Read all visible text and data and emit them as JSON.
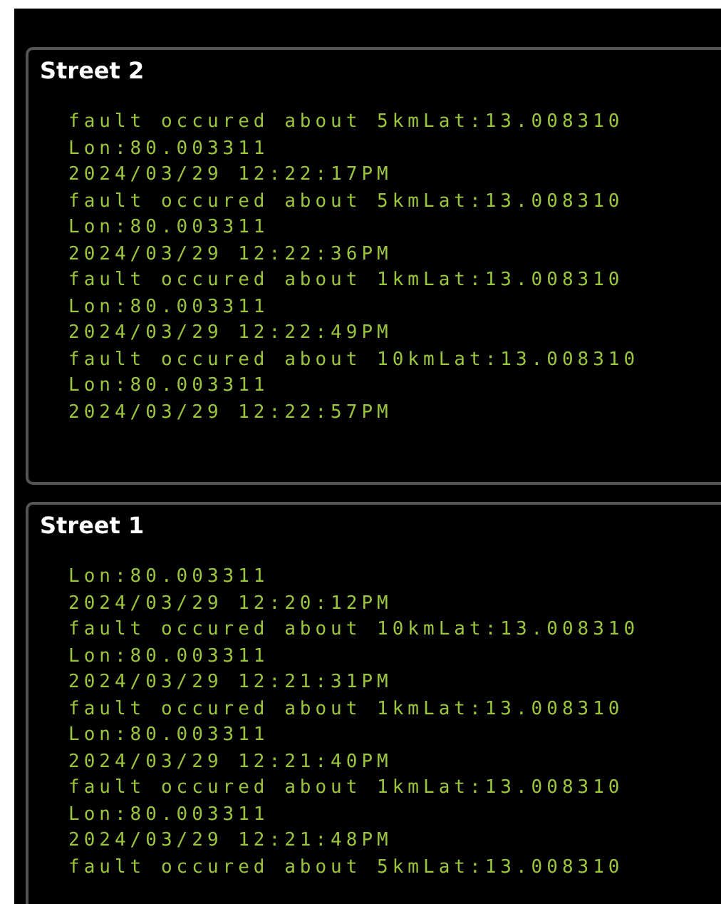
{
  "panels": [
    {
      "title": "Street 2",
      "lines": [
        "fault occured about 5kmLat:13.008310",
        "Lon:80.003311",
        "2024/03/29 12:22:17PM",
        "fault occured about 5kmLat:13.008310",
        "Lon:80.003311",
        "2024/03/29 12:22:36PM",
        "fault occured about 1kmLat:13.008310",
        "Lon:80.003311",
        "2024/03/29 12:22:49PM",
        "fault occured about 10kmLat:13.008310",
        "Lon:80.003311",
        "2024/03/29 12:22:57PM"
      ]
    },
    {
      "title": "Street 1",
      "lines": [
        "Lon:80.003311",
        "2024/03/29 12:20:12PM",
        "fault occured about 10kmLat:13.008310",
        "Lon:80.003311",
        "2024/03/29 12:21:31PM",
        "fault occured about 1kmLat:13.008310",
        "Lon:80.003311",
        "2024/03/29 12:21:40PM",
        "fault occured about 1kmLat:13.008310",
        "Lon:80.003311",
        "2024/03/29 12:21:48PM",
        "fault occured about 5kmLat:13.008310"
      ]
    }
  ]
}
